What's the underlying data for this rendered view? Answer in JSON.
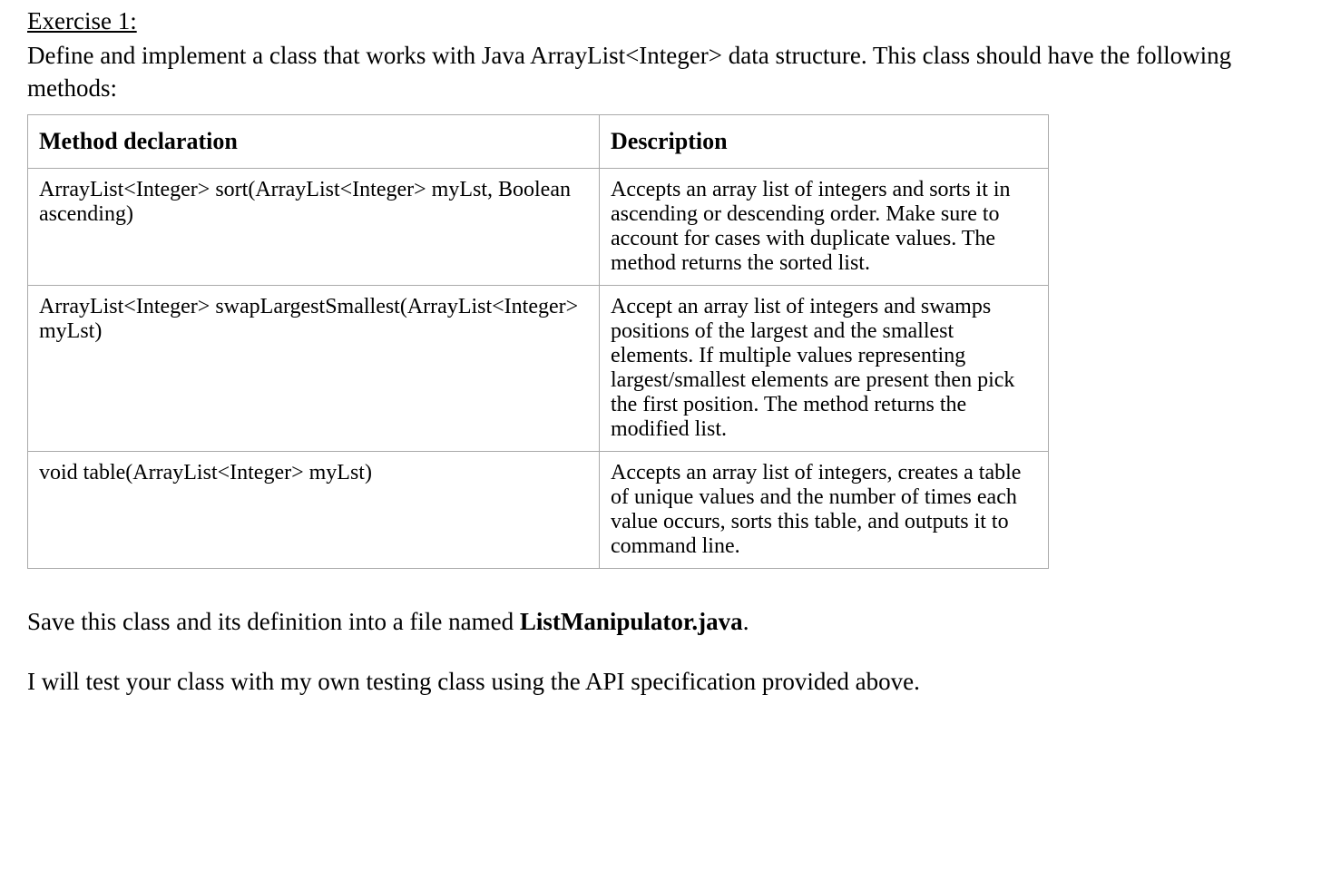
{
  "heading": "Exercise 1:",
  "intro": "Define and implement a class that works with Java ArrayList<Integer> data structure. This class should have the following methods:",
  "table": {
    "headers": {
      "method": "Method declaration",
      "description": "Description"
    },
    "rows": [
      {
        "method": "ArrayList<Integer> sort(ArrayList<Integer> myLst, Boolean ascending)",
        "description": "Accepts an array list of integers and sorts it in ascending or descending order. Make sure to account for cases with duplicate values. The method returns the sorted list."
      },
      {
        "method": "ArrayList<Integer> swapLargestSmallest(ArrayList<Integer> myLst)",
        "description": "Accept an array list of integers and swamps positions of the largest and the smallest elements. If multiple values representing largest/smallest elements are present then pick the first position. The method returns the modified list."
      },
      {
        "method": "void table(ArrayList<Integer> myLst)",
        "description": "Accepts an array list of integers, creates a table of unique values and the number of times each value occurs, sorts this table, and outputs it to command line."
      }
    ]
  },
  "outro1_prefix": "Save this class and its definition into a file named ",
  "outro1_bold": "ListManipulator.java",
  "outro1_suffix": ".",
  "outro2": "I will test your class with my own testing class using the API specification provided above."
}
